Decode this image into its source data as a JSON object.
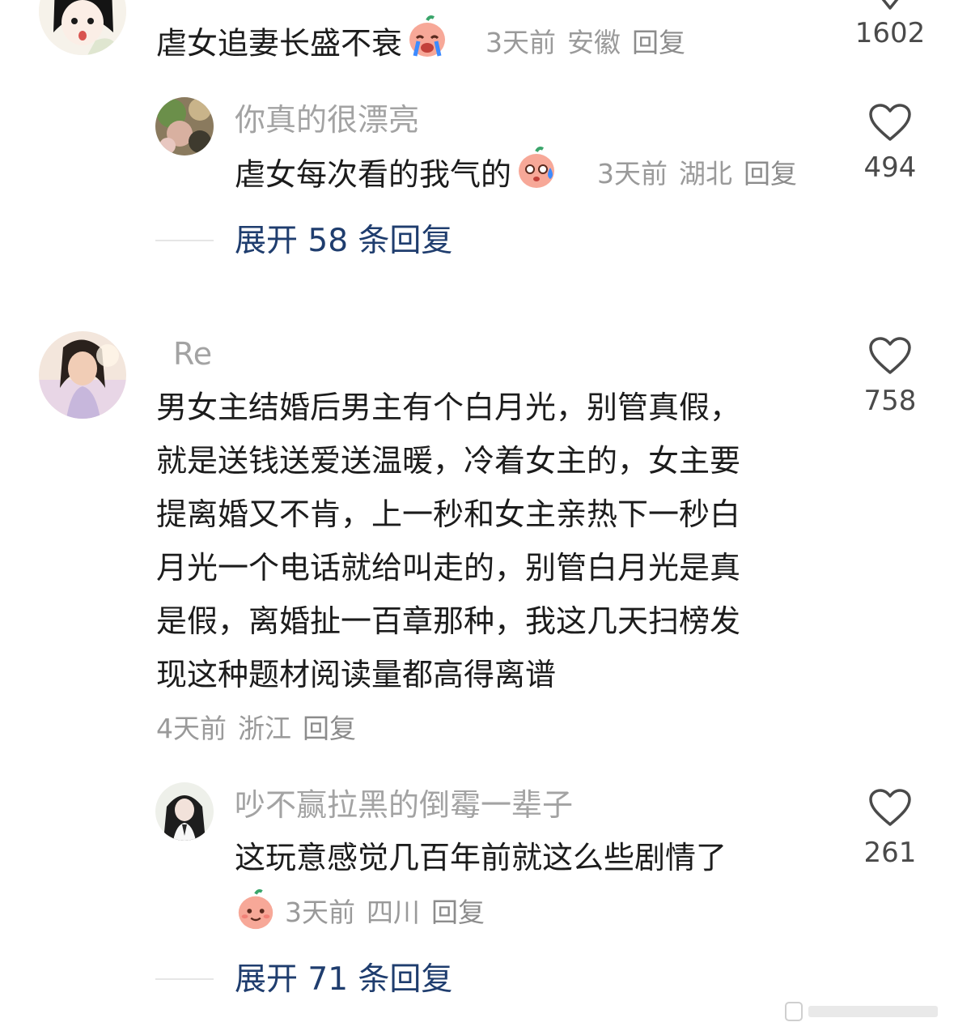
{
  "comment1": {
    "text": "虐女追妻长盛不衰",
    "meta": {
      "time": "3天前",
      "location": "安徽",
      "reply": "回复"
    },
    "likes": "1602"
  },
  "reply1": {
    "username": "你真的很漂亮",
    "text": "虐女每次看的我气的",
    "meta": {
      "time": "3天前",
      "location": "湖北",
      "reply": "回复"
    },
    "likes": "494"
  },
  "expand1": {
    "label": "展开 58 条回复"
  },
  "comment2": {
    "username": "Re",
    "lines": [
      "男女主结婚后男主有个白月光，别管真假，",
      "就是送钱送爱送温暖，冷着女主的，女主要",
      "提离婚又不肯，上一秒和女主亲热下一秒白",
      "月光一个电话就给叫走的，别管白月光是真",
      "是假，离婚扯一百章那种，我这几天扫榜发",
      "现这种题材阅读量都高得离谱"
    ],
    "meta": {
      "time": "4天前",
      "location": "浙江",
      "reply": "回复"
    },
    "likes": "758"
  },
  "reply2": {
    "username": "吵不赢拉黑的倒霉一辈子",
    "text": "这玩意感觉几百年前就这么些剧情了",
    "meta": {
      "time": "3天前",
      "location": "四川",
      "reply": "回复"
    },
    "likes": "261"
  },
  "expand2": {
    "label": "展开 71 条回复"
  },
  "icons": {
    "like": "heart-outline-icon",
    "emoji_crying": "crying-peach-emoji",
    "emoji_sweat": "sweating-peach-emoji",
    "emoji_smile": "smiling-peach-emoji"
  },
  "colors": {
    "expand": "#1f3d6e",
    "meta": "#9a9a9a",
    "username": "#a3a3a3"
  }
}
